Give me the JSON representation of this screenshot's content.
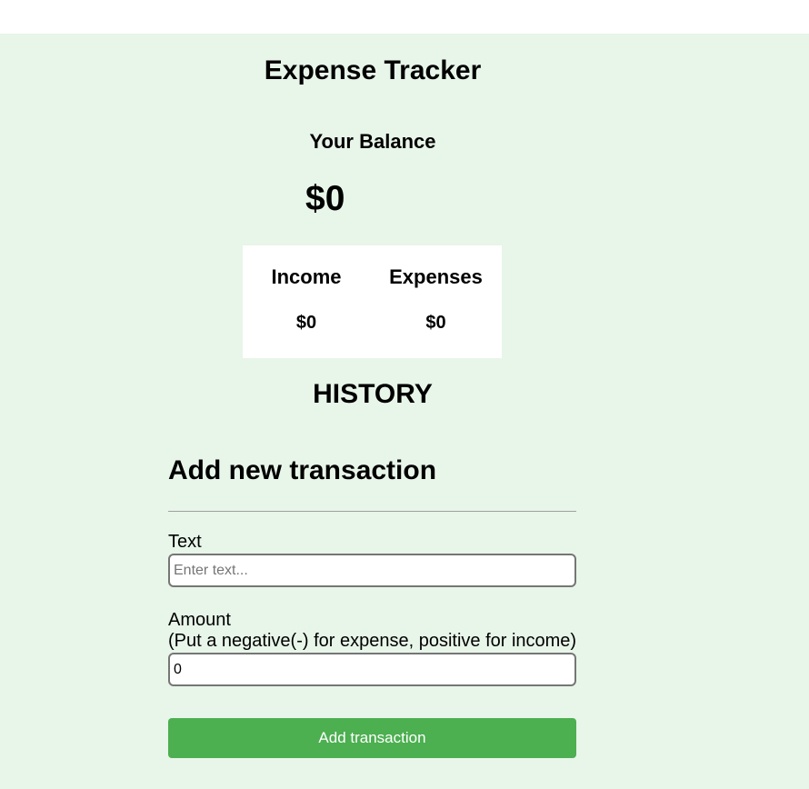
{
  "app": {
    "title": "Expense Tracker",
    "background_color": "#e8f5e9"
  },
  "balance": {
    "label": "Your Balance",
    "value": "$0"
  },
  "summary": {
    "income_label": "Income",
    "income_value": "$0",
    "expense_label": "Expenses",
    "expense_value": "$0"
  },
  "history": {
    "title": "HISTORY"
  },
  "form": {
    "title": "Add new transaction",
    "text_label": "Text",
    "text_placeholder": "Enter text...",
    "text_value": "",
    "amount_label": "Amount",
    "amount_hint": "(Put a negative(-) for expense, positive for income)",
    "amount_value": "0",
    "submit_label": "Add transaction",
    "submit_color": "#4caf50"
  }
}
